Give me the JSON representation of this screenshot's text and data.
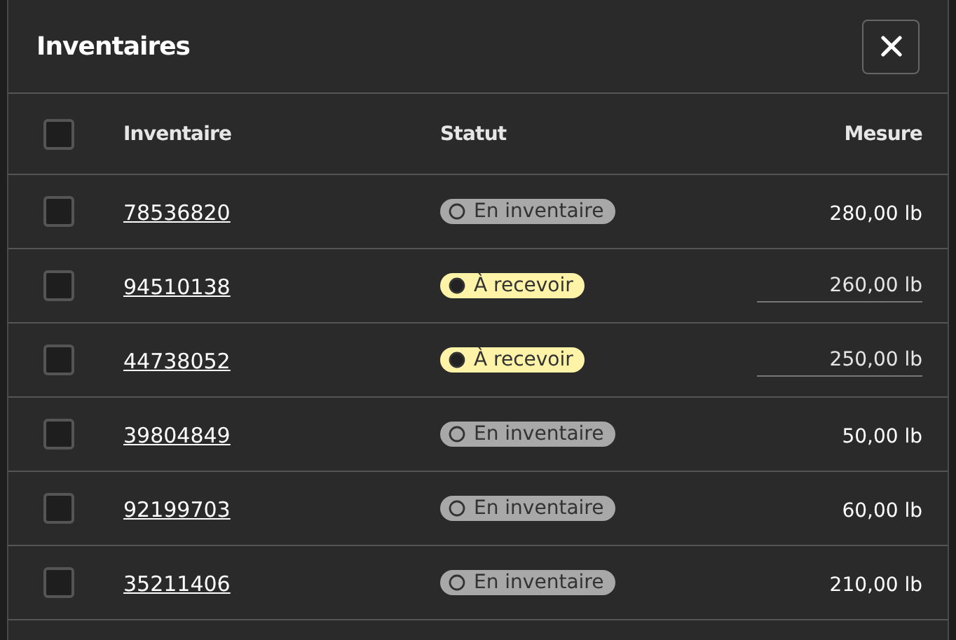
{
  "dialog": {
    "title": "Inventaires"
  },
  "table": {
    "columns": [
      "Inventaire",
      "Statut",
      "Mesure"
    ],
    "select_all": {
      "checked": false
    },
    "rows": [
      {
        "checked": false,
        "id": "78536820",
        "status": {
          "label": "En inventaire",
          "kind": "stocked"
        },
        "measure": "280,00 lb",
        "editable": false
      },
      {
        "checked": false,
        "id": "94510138",
        "status": {
          "label": "À recevoir",
          "kind": "pending"
        },
        "measure": "260,00 lb",
        "editable": true
      },
      {
        "checked": false,
        "id": "44738052",
        "status": {
          "label": "À recevoir",
          "kind": "pending"
        },
        "measure": "250,00 lb",
        "editable": true
      },
      {
        "checked": false,
        "id": "39804849",
        "status": {
          "label": "En inventaire",
          "kind": "stocked"
        },
        "measure": "50,00 lb",
        "editable": false
      },
      {
        "checked": false,
        "id": "92199703",
        "status": {
          "label": "En inventaire",
          "kind": "stocked"
        },
        "measure": "60,00 lb",
        "editable": false
      },
      {
        "checked": false,
        "id": "35211406",
        "status": {
          "label": "En inventaire",
          "kind": "stocked"
        },
        "measure": "210,00 lb",
        "editable": false
      }
    ]
  }
}
